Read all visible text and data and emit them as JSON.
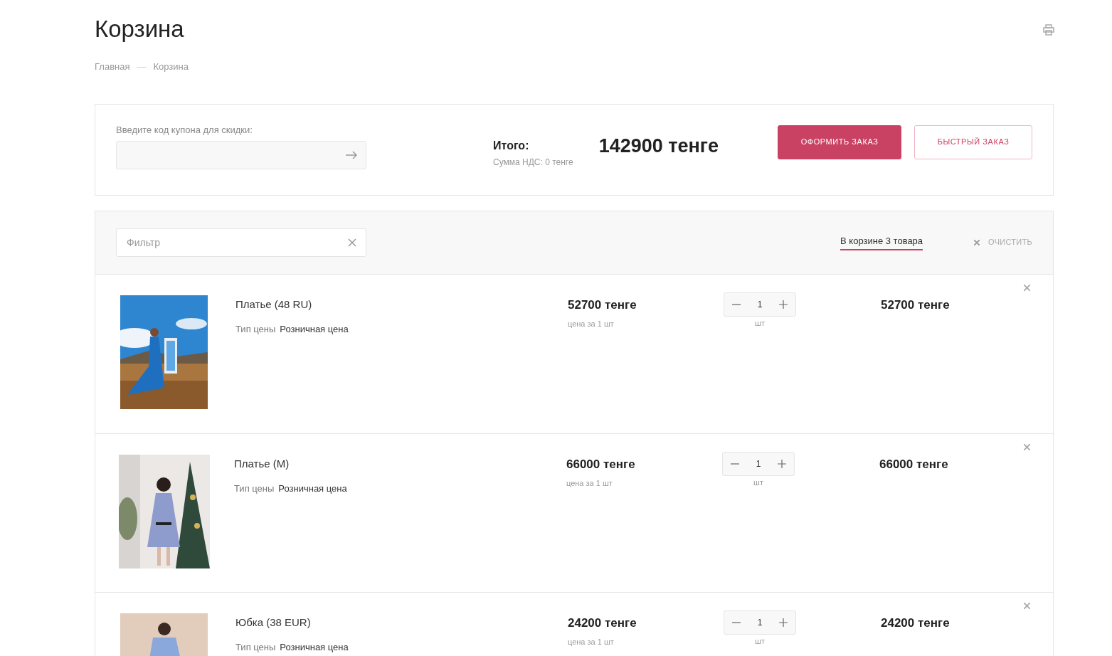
{
  "page": {
    "title": "Корзина"
  },
  "breadcrumbs": [
    {
      "label": "Главная"
    },
    {
      "label": "Корзина"
    }
  ],
  "breadcrumb_separator": "—",
  "coupon": {
    "label": "Введите код купона для скидки:"
  },
  "summary": {
    "total_label": "Итого:",
    "vat": "Сумма НДС: 0 тенге",
    "total": "142900 тенге"
  },
  "buttons": [
    {
      "label": "ОФОРМИТЬ ЗАКАЗ",
      "kind": "primary"
    },
    {
      "label": "БЫСТРЫЙ ЗАКАЗ",
      "kind": "outline"
    }
  ],
  "filter": {
    "placeholder": "Фильтр"
  },
  "tabs": [
    {
      "label": "В корзине 3 товара",
      "selected": true
    }
  ],
  "clear": {
    "label": "ОЧИСТИТЬ"
  },
  "items": [
    {
      "name": "Платье (48 RU)",
      "price_type_label": "Тип цены",
      "price_type": "Розничная цена",
      "price": "52700 тенге",
      "price_note": "цена за 1 шт",
      "quantity": "1",
      "unit": "шт",
      "total": "52700 тенге"
    },
    {
      "name": "Платье (M)",
      "price_type_label": "Тип цены",
      "price_type": "Розничная цена",
      "price": "66000 тенге",
      "price_note": "цена за 1 шт",
      "quantity": "1",
      "unit": "шт",
      "total": "66000 тенге"
    },
    {
      "name": "Юбка (38 EUR)",
      "price_type_label": "Тип цены",
      "price_type": "Розничная цена",
      "price": "24200 тенге",
      "price_note": "цена за 1 шт",
      "quantity": "1",
      "unit": "шт",
      "total": "24200 тенге"
    }
  ]
}
